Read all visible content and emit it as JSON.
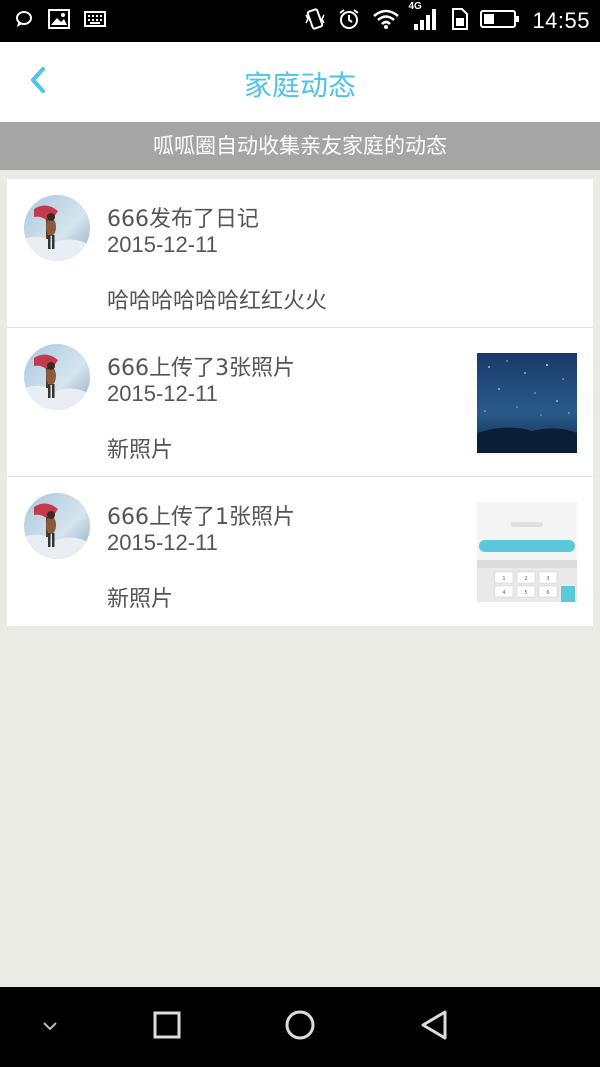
{
  "status_bar": {
    "time": "14:55",
    "network": "4G",
    "icons": [
      "chat-icon",
      "image-icon",
      "keyboard-icon",
      "vibrate-icon",
      "alarm-icon",
      "wifi-icon",
      "signal-icon",
      "sim-icon",
      "battery-icon"
    ]
  },
  "header": {
    "title": "家庭动态",
    "back_icon": "chevron-left-icon"
  },
  "banner": {
    "text": "呱呱圈自动收集亲友家庭的动态"
  },
  "feed": [
    {
      "title": "666发布了日记",
      "date": "2015-12-11",
      "content": "哈哈哈哈哈哈红红火火",
      "thumbnail": ""
    },
    {
      "title": "666上传了3张照片",
      "date": "2015-12-11",
      "content": "新照片",
      "thumbnail": "starry-night-photo"
    },
    {
      "title": "666上传了1张照片",
      "date": "2015-12-11",
      "content": "新照片",
      "thumbnail": "keyboard-screenshot-photo"
    }
  ],
  "thumb_keys": [
    "1",
    "2",
    "3",
    "4",
    "5",
    "6"
  ],
  "nav_bar": {
    "icons": [
      "chevron-down-icon",
      "recent-apps-icon",
      "home-icon",
      "back-icon"
    ]
  },
  "colors": {
    "accent": "#4fc3e8",
    "banner_bg": "#a5a5a5",
    "page_bg": "#ebebe6"
  }
}
